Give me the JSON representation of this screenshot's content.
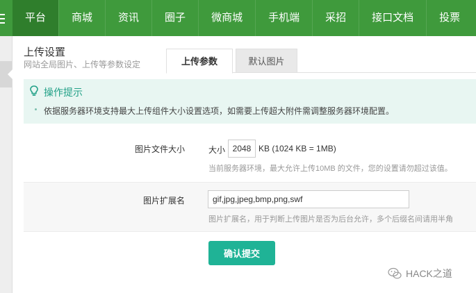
{
  "nav": {
    "items": [
      "平台",
      "商城",
      "资讯",
      "圈子",
      "微商城",
      "手机端",
      "采招",
      "接口文档",
      "投票"
    ],
    "active_index": 0
  },
  "header": {
    "title": "上传设置",
    "subtitle": "网站全局图片、上传等参数设定"
  },
  "tabs": [
    {
      "label": "上传参数",
      "active": true
    },
    {
      "label": "默认图片",
      "active": false
    }
  ],
  "tips": {
    "title": "操作提示",
    "items": [
      "依据服务器环境支持最大上传组件大小设置选项，如需要上传超大附件需调整服务器环境配置。"
    ]
  },
  "form": {
    "file_size": {
      "label": "图片文件大小",
      "prefix": "大小",
      "value": "2048",
      "suffix": "KB (1024 KB = 1MB)",
      "hint": "当前服务器环境，最大允许上传10MB 的文件，您的设置请勿超过该值。"
    },
    "extension": {
      "label": "图片扩展名",
      "value": "gif,jpg,jpeg,bmp,png,swf",
      "hint": "图片扩展名，用于判断上传图片是否为后台允许，多个后缀名间请用半角"
    },
    "submit_label": "确认提交"
  },
  "watermark": {
    "text": "HACK之道"
  },
  "colors": {
    "nav_bg": "#3f9a3c",
    "nav_active": "#2f7e2c",
    "accent": "#1fb396",
    "tips_bg": "#e8f6f2",
    "tips_title": "#21a087"
  }
}
